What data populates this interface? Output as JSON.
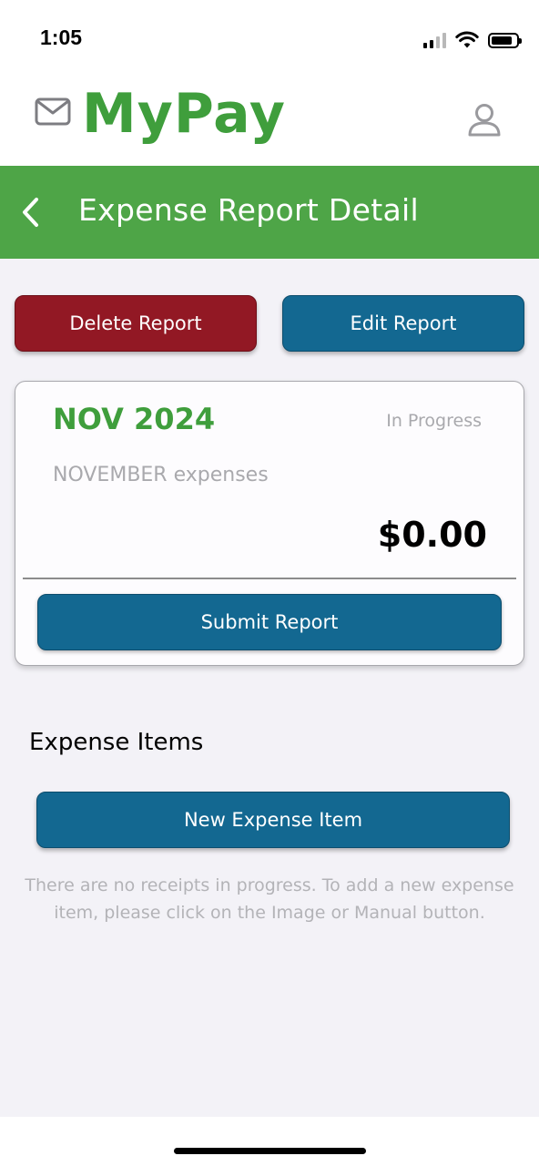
{
  "status_bar": {
    "time": "1:05",
    "battery_level": 0.72,
    "signal_bars": 2
  },
  "header": {
    "brand": "MyPay",
    "left_icon": "mail-icon",
    "right_icon": "profile-icon",
    "brand_color": "#3f9e3c"
  },
  "title_bar": {
    "back_icon": "chevron-left-icon",
    "title": "Expense Report Detail",
    "background_color": "#4ea547"
  },
  "actions": {
    "delete_label": "Delete Report",
    "edit_label": "Edit Report",
    "delete_color": "#921824",
    "edit_color": "#136891"
  },
  "report": {
    "period": "NOV 2024",
    "status": "In Progress",
    "description": "NOVEMBER expenses",
    "total": "$0.00",
    "submit_label": "Submit Report"
  },
  "expense_items": {
    "heading": "Expense Items",
    "new_button_label": "New Expense Item",
    "empty_message": "There are no receipts in progress. To add a new expense item, please click on the Image or Manual button."
  }
}
